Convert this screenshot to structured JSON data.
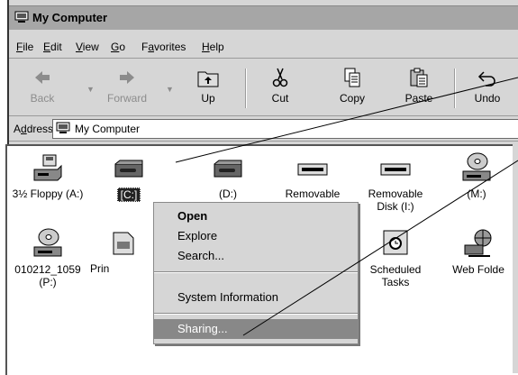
{
  "window": {
    "title": "My Computer"
  },
  "menu": [
    {
      "label": "File",
      "key": "F"
    },
    {
      "label": "Edit",
      "key": "E"
    },
    {
      "label": "View",
      "key": "V"
    },
    {
      "label": "Go",
      "key": "G"
    },
    {
      "label": "Favorites",
      "key": "a"
    },
    {
      "label": "Help",
      "key": "H"
    }
  ],
  "toolbar": {
    "back": {
      "label": "Back",
      "icon": "back-arrow-icon",
      "enabled": false
    },
    "forward": {
      "label": "Forward",
      "icon": "forward-arrow-icon",
      "enabled": false
    },
    "up": {
      "label": "Up",
      "icon": "up-folder-icon",
      "enabled": true
    },
    "cut": {
      "label": "Cut",
      "icon": "scissors-icon",
      "enabled": true
    },
    "copy": {
      "label": "Copy",
      "icon": "copy-icon",
      "enabled": true
    },
    "paste": {
      "label": "Paste",
      "icon": "paste-icon",
      "enabled": true
    },
    "undo": {
      "label": "Undo",
      "icon": "undo-icon",
      "enabled": true
    }
  },
  "address": {
    "label": "Address",
    "value": "My Computer"
  },
  "items": [
    {
      "label": "3½ Floppy (A:)",
      "icon": "floppy-drive-icon"
    },
    {
      "label": "[C:]",
      "icon": "hard-drive-icon",
      "selected": true
    },
    {
      "label": "(D:)",
      "icon": "hard-drive-icon"
    },
    {
      "label": "Removable",
      "icon": "removable-drive-icon"
    },
    {
      "label": "Removable Disk (I:)",
      "icon": "removable-drive-icon"
    },
    {
      "label": "(M:)",
      "icon": "cd-drive-icon"
    },
    {
      "label": "010212_1059 (P:)",
      "icon": "cd-drive-icon"
    },
    {
      "label": "Prin",
      "icon": "printers-icon"
    },
    {
      "label": "Scheduled Tasks",
      "icon": "scheduled-tasks-icon"
    },
    {
      "label": "Web Folde",
      "icon": "web-folders-icon"
    }
  ],
  "context_menu": {
    "open": "Open",
    "explore": "Explore",
    "search": "Search...",
    "system_info": "System Information",
    "sharing": "Sharing..."
  },
  "colors": {
    "titlebar": "#a6a6a6",
    "chrome": "#d6d6d6",
    "highlight": "#888888"
  }
}
